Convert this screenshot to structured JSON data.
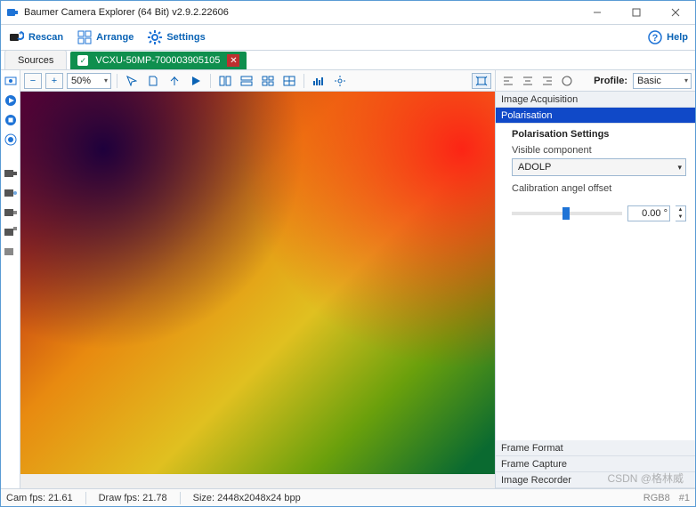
{
  "window": {
    "title": "Baumer Camera Explorer (64 Bit) v2.9.2.22606"
  },
  "toolbar": {
    "rescan": "Rescan",
    "arrange": "Arrange",
    "settings": "Settings",
    "help": "Help"
  },
  "tabs": {
    "sources": "Sources",
    "camera": "VCXU-50MP-700003905105"
  },
  "image_toolbar": {
    "zoom": "50%"
  },
  "right_panel": {
    "profile_label": "Profile:",
    "profile_value": "Basic",
    "sections": {
      "acq": "Image Acquisition",
      "pol": "Polarisation",
      "frame_format": "Frame Format",
      "frame_capture": "Frame Capture",
      "image_recorder": "Image Recorder"
    },
    "pol_settings": {
      "heading": "Polarisation Settings",
      "visible_label": "Visible component",
      "visible_value": "ADOLP",
      "calib_label": "Calibration angel offset",
      "calib_value": "0.00 °"
    }
  },
  "status": {
    "cam_fps": "Cam fps: 21.61",
    "draw_fps": "Draw fps: 21.78",
    "size": "Size: 2448x2048x24 bpp",
    "format": "RGB8",
    "flag": "#1"
  },
  "watermark": "CSDN @格林威"
}
